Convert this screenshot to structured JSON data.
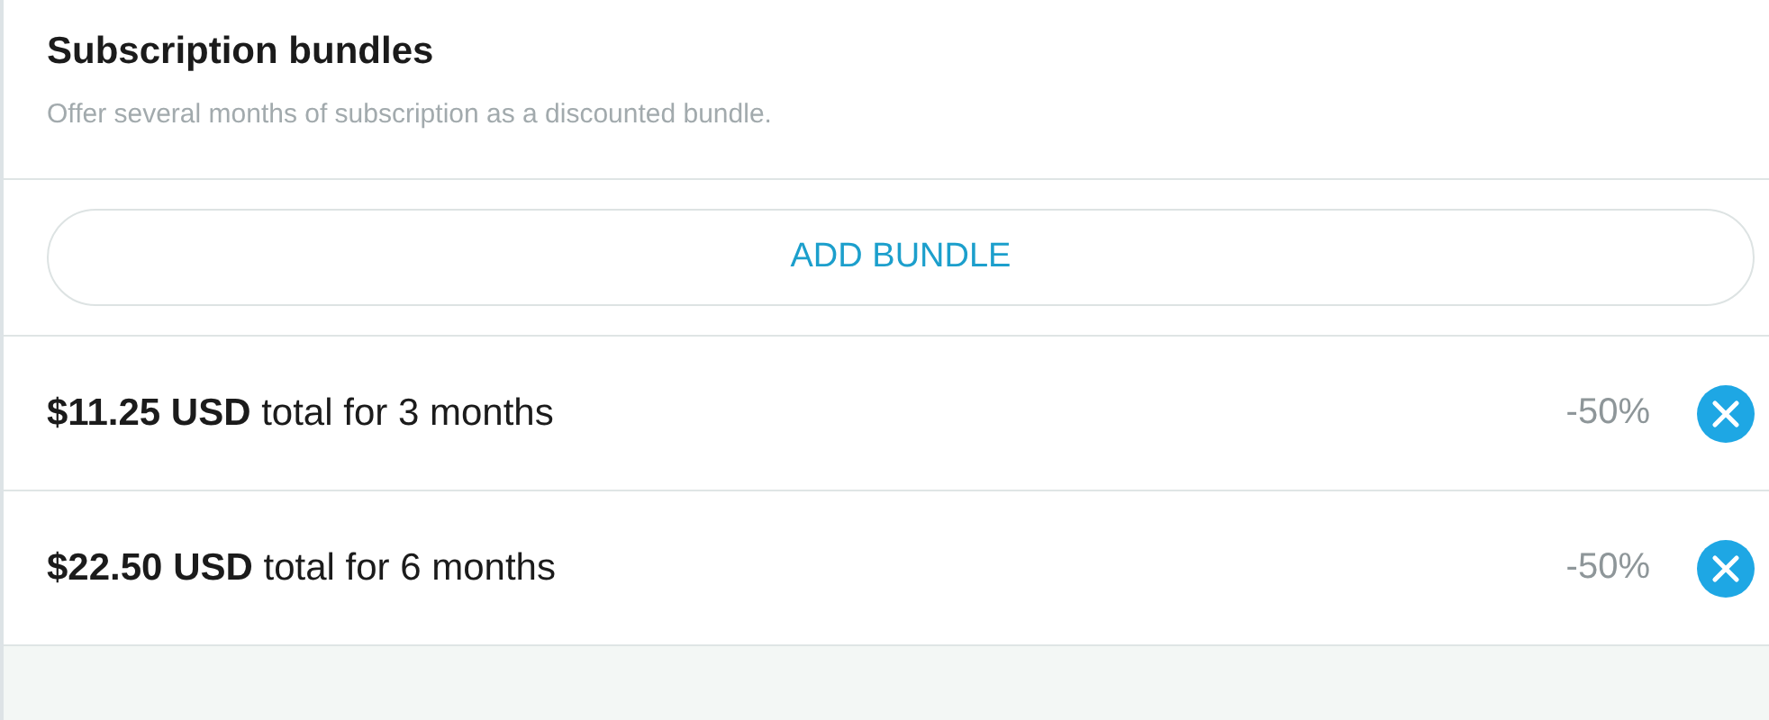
{
  "section": {
    "title": "Subscription bundles",
    "description": "Offer several months of subscription as a discounted bundle."
  },
  "add_button": {
    "label": "ADD BUNDLE"
  },
  "bundles": [
    {
      "summary": "**$11.25 USD** total for 3 months",
      "discount": "-50%"
    },
    {
      "summary": "**$22.50 USD** total for 6 months",
      "discount": "-50%"
    }
  ]
}
